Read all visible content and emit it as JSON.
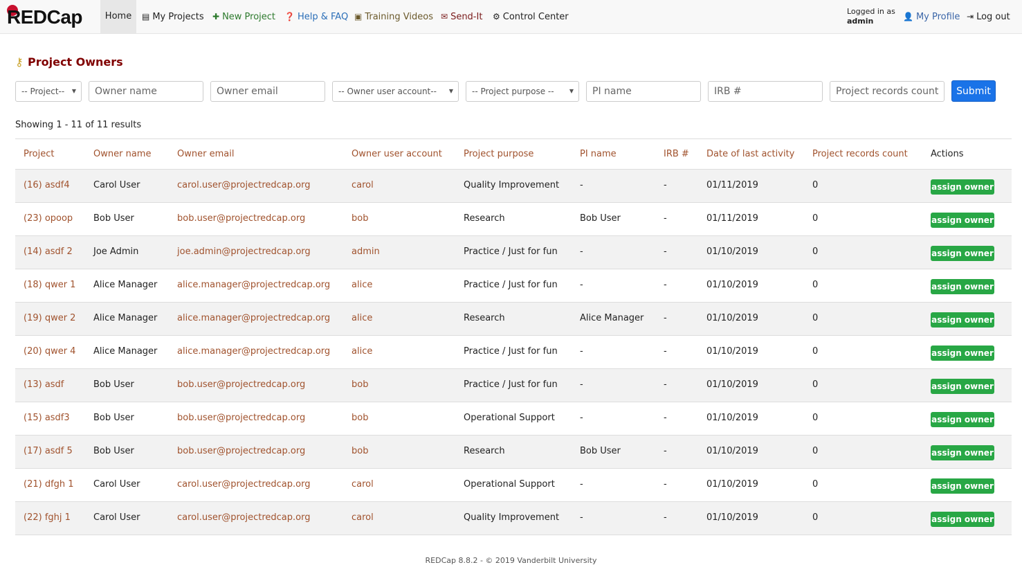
{
  "nav": {
    "logo": "REDCap",
    "home": "Home",
    "my_projects": "My Projects",
    "new_project": "New Project",
    "help": "Help & FAQ",
    "training": "Training Videos",
    "send_it": "Send-It",
    "control_center": "Control Center",
    "logged_in_as": "Logged in as",
    "username": "admin",
    "my_profile": "My Profile",
    "log_out": "Log out"
  },
  "page_title": "Project Owners",
  "filters": {
    "project": "-- Project--",
    "owner_name": "Owner name",
    "owner_email": "Owner email",
    "owner_account": "-- Owner user account--",
    "purpose": "-- Project purpose --",
    "pi_name": "PI name",
    "irb": "IRB #",
    "records_count": "Project records count",
    "submit": "Submit"
  },
  "showing": "Showing 1 - 11 of 11 results",
  "table": {
    "headers": {
      "project": "Project",
      "owner": "Owner name",
      "email": "Owner email",
      "account": "Owner user account",
      "purpose": "Project purpose",
      "pi": "PI name",
      "irb": "IRB #",
      "date": "Date of last activity",
      "count": "Project records count",
      "actions": "Actions"
    },
    "action_label": "assign owner",
    "rows": [
      {
        "project": "(16) asdf4",
        "owner": "Carol User",
        "email": "carol.user@projectredcap.org",
        "account": "carol",
        "purpose": "Quality Improvement",
        "pi": "-",
        "irb": "-",
        "date": "01/11/2019",
        "count": "0"
      },
      {
        "project": "(23) opoop",
        "owner": "Bob User",
        "email": "bob.user@projectredcap.org",
        "account": "bob",
        "purpose": "Research",
        "pi": "Bob User",
        "irb": "-",
        "date": "01/11/2019",
        "count": "0"
      },
      {
        "project": "(14) asdf 2",
        "owner": "Joe Admin",
        "email": "joe.admin@projectredcap.org",
        "account": "admin",
        "purpose": "Practice / Just for fun",
        "pi": "-",
        "irb": "-",
        "date": "01/10/2019",
        "count": "0"
      },
      {
        "project": "(18) qwer 1",
        "owner": "Alice Manager",
        "email": "alice.manager@projectredcap.org",
        "account": "alice",
        "purpose": "Practice / Just for fun",
        "pi": "-",
        "irb": "-",
        "date": "01/10/2019",
        "count": "0"
      },
      {
        "project": "(19) qwer 2",
        "owner": "Alice Manager",
        "email": "alice.manager@projectredcap.org",
        "account": "alice",
        "purpose": "Research",
        "pi": "Alice Manager",
        "irb": "-",
        "date": "01/10/2019",
        "count": "0"
      },
      {
        "project": "(20) qwer 4",
        "owner": "Alice Manager",
        "email": "alice.manager@projectredcap.org",
        "account": "alice",
        "purpose": "Practice / Just for fun",
        "pi": "-",
        "irb": "-",
        "date": "01/10/2019",
        "count": "0"
      },
      {
        "project": "(13) asdf",
        "owner": "Bob User",
        "email": "bob.user@projectredcap.org",
        "account": "bob",
        "purpose": "Practice / Just for fun",
        "pi": "-",
        "irb": "-",
        "date": "01/10/2019",
        "count": "0"
      },
      {
        "project": "(15) asdf3",
        "owner": "Bob User",
        "email": "bob.user@projectredcap.org",
        "account": "bob",
        "purpose": "Operational Support",
        "pi": "-",
        "irb": "-",
        "date": "01/10/2019",
        "count": "0"
      },
      {
        "project": "(17) asdf 5",
        "owner": "Bob User",
        "email": "bob.user@projectredcap.org",
        "account": "bob",
        "purpose": "Research",
        "pi": "Bob User",
        "irb": "-",
        "date": "01/10/2019",
        "count": "0"
      },
      {
        "project": "(21) dfgh 1",
        "owner": "Carol User",
        "email": "carol.user@projectredcap.org",
        "account": "carol",
        "purpose": "Operational Support",
        "pi": "-",
        "irb": "-",
        "date": "01/10/2019",
        "count": "0"
      },
      {
        "project": "(22) fghj 1",
        "owner": "Carol User",
        "email": "carol.user@projectredcap.org",
        "account": "carol",
        "purpose": "Quality Improvement",
        "pi": "-",
        "irb": "-",
        "date": "01/10/2019",
        "count": "0"
      }
    ]
  },
  "footer": "REDCap 8.8.2 - © 2019 Vanderbilt University"
}
